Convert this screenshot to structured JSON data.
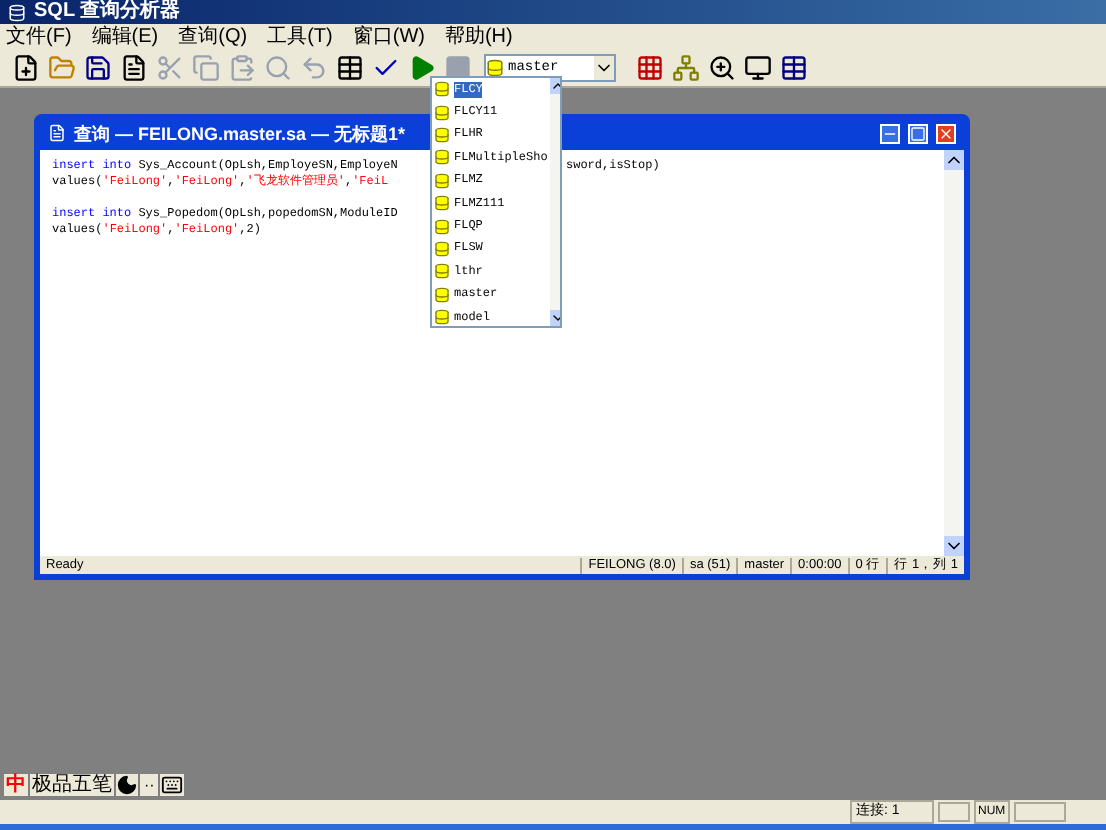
{
  "window": {
    "title": "SQL 查询分析器"
  },
  "menu": [
    {
      "label": "文件(F)"
    },
    {
      "label": "编辑(E)"
    },
    {
      "label": "查询(Q)"
    },
    {
      "label": "工具(T)"
    },
    {
      "label": "窗口(W)"
    },
    {
      "label": "帮助(H)"
    }
  ],
  "toolbar": {
    "database": "master"
  },
  "database_list": [
    {
      "label": "FLCY",
      "selected": true
    },
    {
      "label": "FLCY11",
      "selected": false
    },
    {
      "label": "FLHR",
      "selected": false
    },
    {
      "label": "FLMultipleSho",
      "selected": false
    },
    {
      "label": "FLMZ",
      "selected": false
    },
    {
      "label": "FLMZ111",
      "selected": false
    },
    {
      "label": "FLQP",
      "selected": false
    },
    {
      "label": "FLSW",
      "selected": false
    },
    {
      "label": "lthr",
      "selected": false
    },
    {
      "label": "master",
      "selected": false
    },
    {
      "label": "model",
      "selected": false
    }
  ],
  "query_window": {
    "title": "查询 — FEILONG.master.sa — 无标题1*",
    "code_lines": [
      {
        "left": [
          {
            "kind": "keyword",
            "text": "insert into"
          },
          {
            "kind": "plain",
            "text": " Sys_Account(OpLsh,EmployeSN,EmployeN"
          }
        ],
        "right": [
          {
            "kind": "plain",
            "text": "sword,isStop)"
          }
        ]
      },
      {
        "left": [
          {
            "kind": "plain",
            "text": "values("
          },
          {
            "kind": "string",
            "text": "'FeiLong'"
          },
          {
            "kind": "plain",
            "text": ","
          },
          {
            "kind": "string",
            "text": "'FeiLong'"
          },
          {
            "kind": "plain",
            "text": ","
          },
          {
            "kind": "string",
            "text": "'飞龙软件管理员'"
          },
          {
            "kind": "plain",
            "text": ","
          },
          {
            "kind": "string",
            "text": "'FeiL"
          }
        ]
      },
      {
        "kind": "blank"
      },
      {
        "left": [
          {
            "kind": "keyword",
            "text": "insert into"
          },
          {
            "kind": "plain",
            "text": " Sys_Popedom(OpLsh,popedomSN,ModuleID"
          }
        ]
      },
      {
        "left": [
          {
            "kind": "plain",
            "text": "values("
          },
          {
            "kind": "string",
            "text": "'FeiLong'"
          },
          {
            "kind": "plain",
            "text": ","
          },
          {
            "kind": "string",
            "text": "'FeiLong'"
          },
          {
            "kind": "plain",
            "text": ",2)"
          }
        ]
      }
    ],
    "status": [
      "Ready",
      "FEILONG (8.0)",
      "sa (51)",
      "master",
      "0:00:00",
      "0 行",
      "行 1，列 1"
    ]
  },
  "ime_bar": {
    "mode": "中",
    "name": "极品五笔",
    "punct": "··"
  },
  "status_bar": {
    "connections": "连接: 1",
    "num": "NUM"
  }
}
